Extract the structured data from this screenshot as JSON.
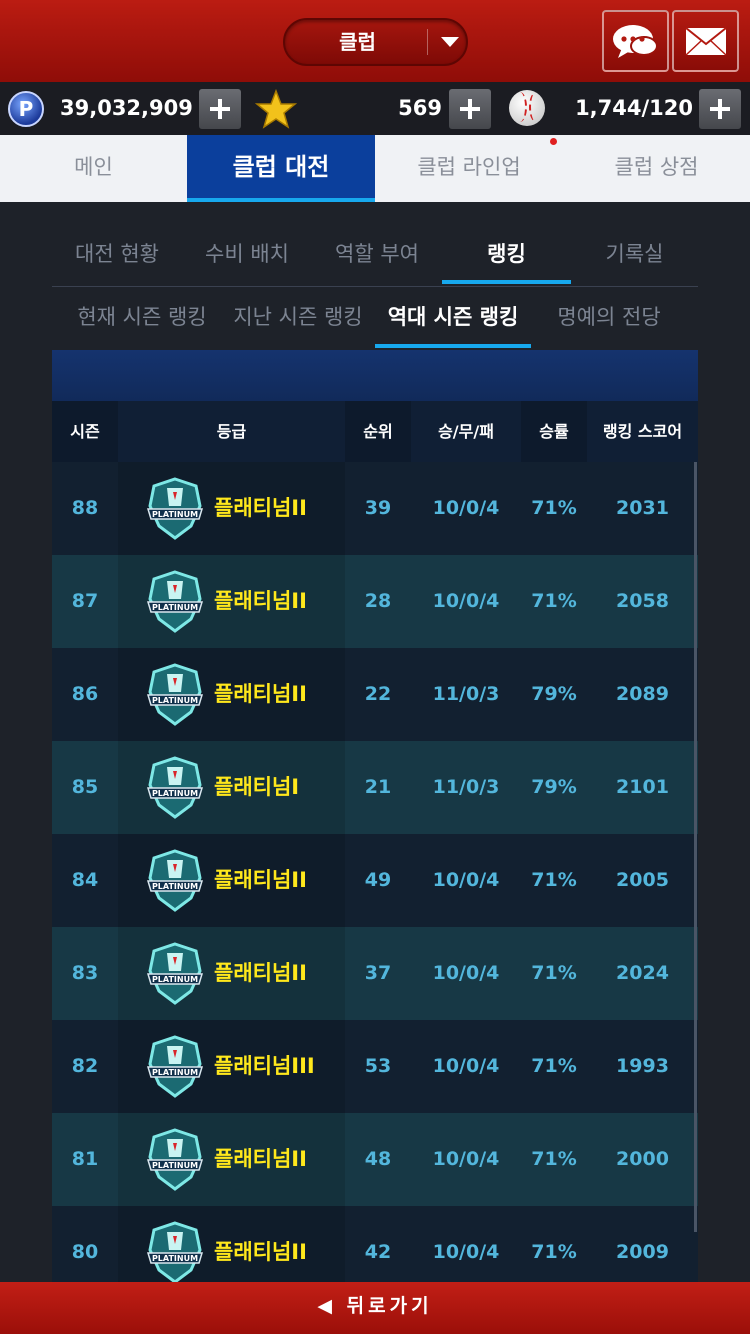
{
  "header": {
    "club_label": "클럽"
  },
  "resources": {
    "points": "39,032,909",
    "stars": "569",
    "balls": "1,744/120"
  },
  "main_tabs": [
    {
      "label": "메인"
    },
    {
      "label": "클럽 대전"
    },
    {
      "label": "클럽 라인업"
    },
    {
      "label": "클럽 상점"
    }
  ],
  "sub_tabs": [
    {
      "label": "대전 현황"
    },
    {
      "label": "수비 배치"
    },
    {
      "label": "역할 부여"
    },
    {
      "label": "랭킹"
    },
    {
      "label": "기록실"
    }
  ],
  "ranking_tabs": [
    {
      "label": "현재 시즌 랭킹"
    },
    {
      "label": "지난 시즌 랭킹"
    },
    {
      "label": "역대 시즌 랭킹"
    },
    {
      "label": "명예의 전당"
    }
  ],
  "table": {
    "headers": {
      "season": "시즌",
      "grade": "등급",
      "rank": "순위",
      "record": "승/무/패",
      "winrate": "승률",
      "score": "랭킹 스코어"
    },
    "rows": [
      {
        "season": "88",
        "grade": "플래티넘II",
        "rank": "39",
        "record": "10/0/4",
        "winrate": "71%",
        "score": "2031"
      },
      {
        "season": "87",
        "grade": "플래티넘II",
        "rank": "28",
        "record": "10/0/4",
        "winrate": "71%",
        "score": "2058"
      },
      {
        "season": "86",
        "grade": "플래티넘II",
        "rank": "22",
        "record": "11/0/3",
        "winrate": "79%",
        "score": "2089"
      },
      {
        "season": "85",
        "grade": "플래티넘I",
        "rank": "21",
        "record": "11/0/3",
        "winrate": "79%",
        "score": "2101"
      },
      {
        "season": "84",
        "grade": "플래티넘II",
        "rank": "49",
        "record": "10/0/4",
        "winrate": "71%",
        "score": "2005"
      },
      {
        "season": "83",
        "grade": "플래티넘II",
        "rank": "37",
        "record": "10/0/4",
        "winrate": "71%",
        "score": "2024"
      },
      {
        "season": "82",
        "grade": "플래티넘III",
        "rank": "53",
        "record": "10/0/4",
        "winrate": "71%",
        "score": "1993"
      },
      {
        "season": "81",
        "grade": "플래티넘II",
        "rank": "48",
        "record": "10/0/4",
        "winrate": "71%",
        "score": "2000"
      },
      {
        "season": "80",
        "grade": "플래티넘II",
        "rank": "42",
        "record": "10/0/4",
        "winrate": "71%",
        "score": "2009"
      }
    ],
    "badge_text": "PLATINUM"
  },
  "footer": {
    "back_label": "◀ 뒤로가기"
  }
}
